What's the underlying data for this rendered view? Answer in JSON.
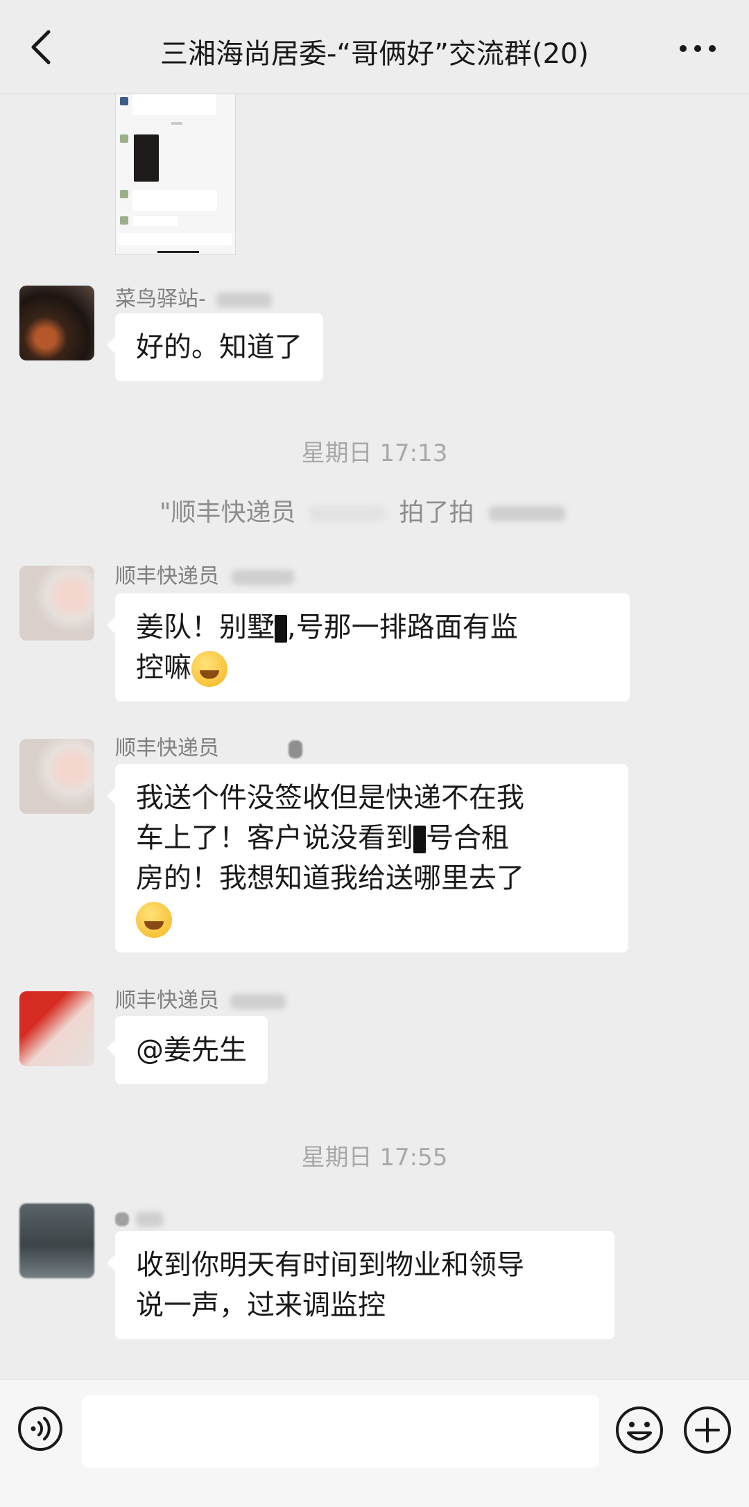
{
  "header": {
    "title": "三湘海尚居委-“哥俩好”交流群(20)"
  },
  "messages": {
    "m1": {
      "sender": "菜鸟驿站-",
      "text": "好的。知道了"
    },
    "time1": "星期日 17:13",
    "system1": {
      "part1": "\"顺丰快递员",
      "part2": "拍了拍"
    },
    "m2": {
      "sender": "顺丰快递员",
      "line1a": "姜队！别墅",
      "line1b": "号那一排路面有监",
      "line2": "控嘛"
    },
    "m3": {
      "sender": "顺丰快递员",
      "line1": "我送个件没签收但是快递不在我",
      "line2a": "车上了！客户说没看到",
      "line2b": "号合租",
      "line3": "房的！我想知道我给送哪里去了"
    },
    "m4": {
      "sender": "顺丰快递员",
      "text": "@姜先生"
    },
    "time2": "星期日 17:55",
    "m5": {
      "line1": "收到你明天有时间到物业和领导",
      "line2": "说一声，过来调监控"
    }
  },
  "icons": {
    "back": "back-chevron-icon",
    "more": "more-dots-icon",
    "voice": "voice-icon",
    "emoji": "emoji-icon",
    "plus": "plus-icon"
  }
}
